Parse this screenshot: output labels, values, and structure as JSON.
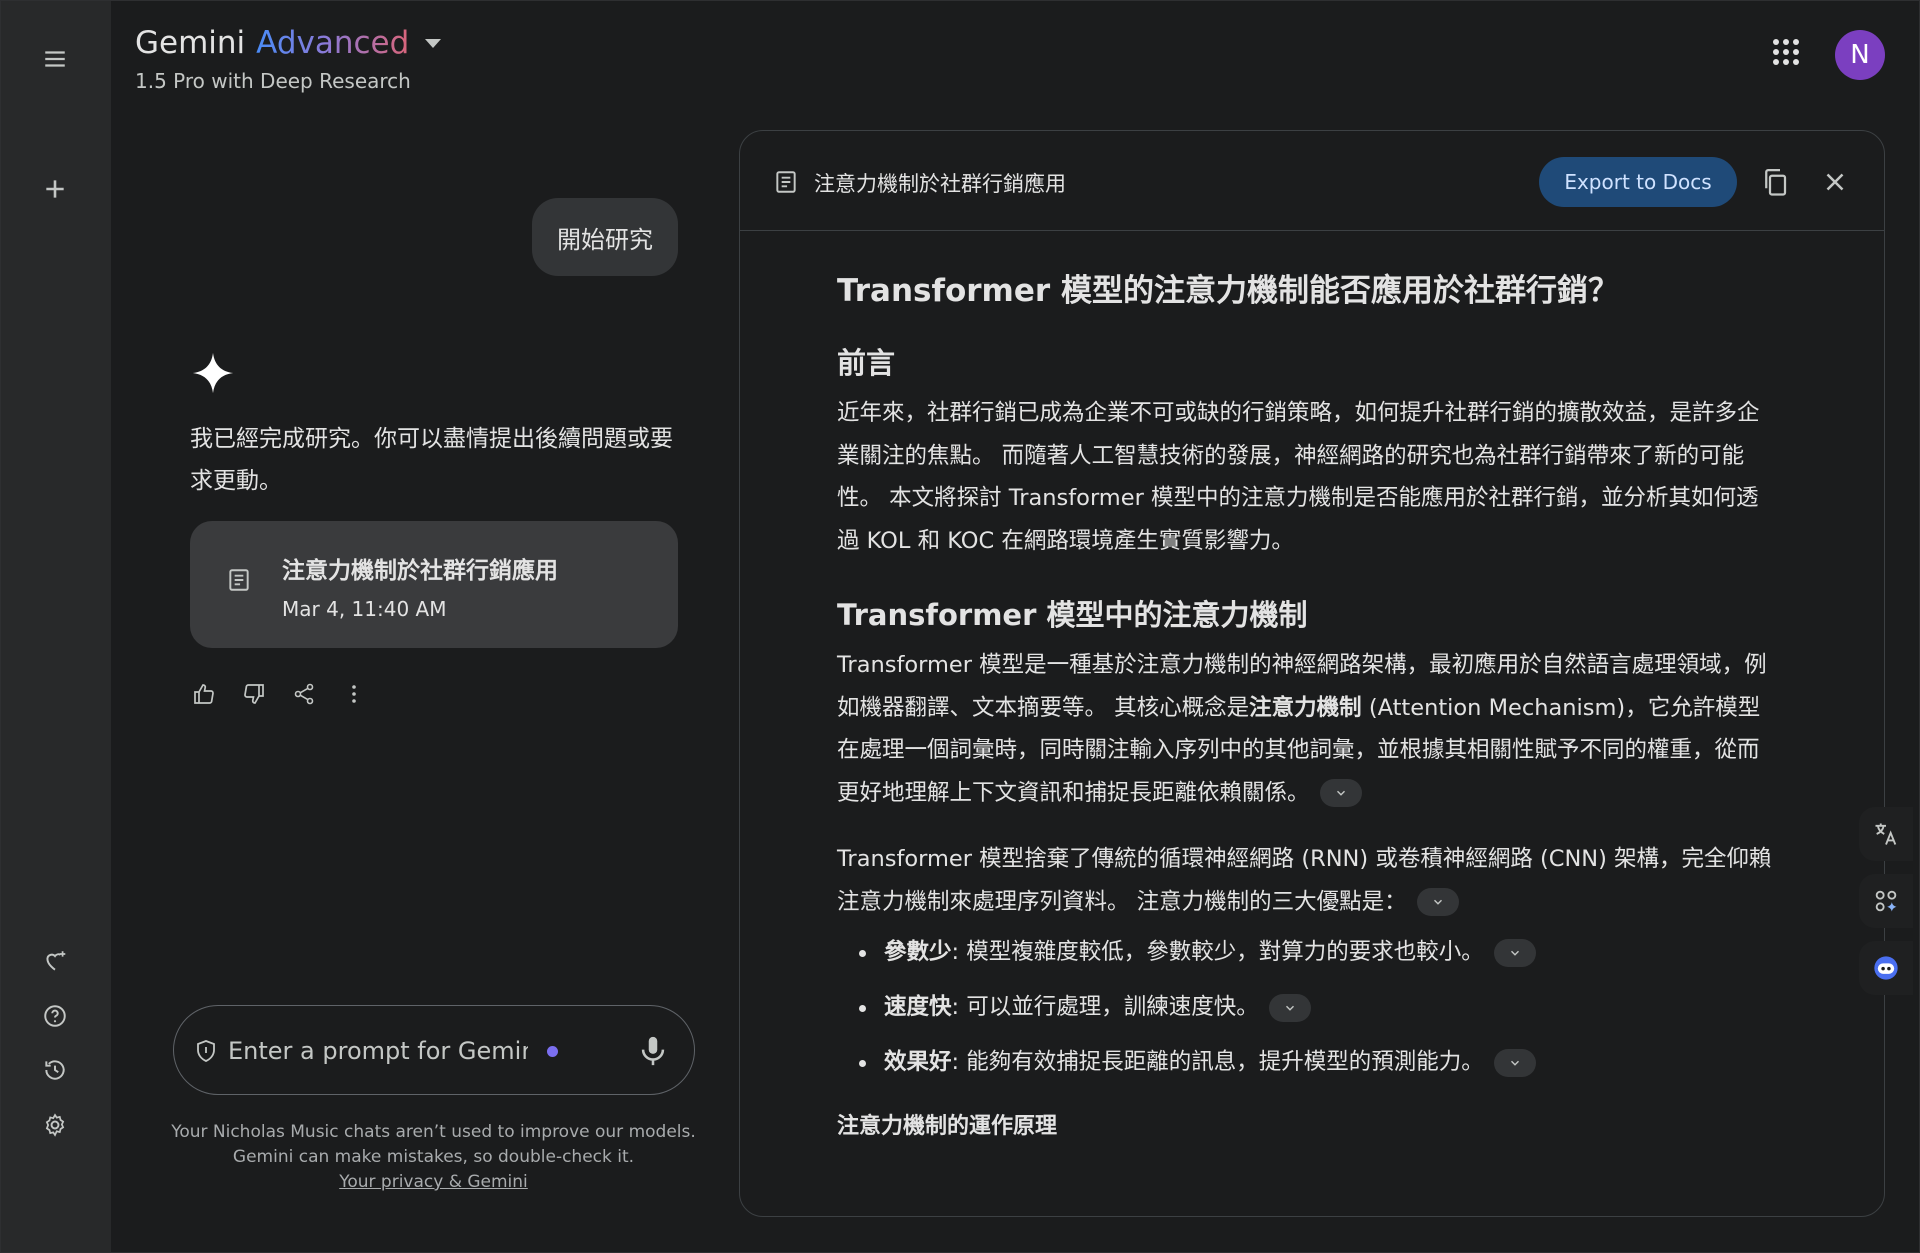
{
  "header": {
    "brand_name": "Gemini",
    "brand_tier": "Advanced",
    "model_label": "1.5 Pro with Deep Research",
    "avatar_initial": "N"
  },
  "sidebar": {
    "icons": [
      "menu-icon",
      "new-chat-icon",
      "gem-manager-icon",
      "help-icon",
      "activity-icon",
      "settings-icon"
    ]
  },
  "chat": {
    "user_message": "開始研究",
    "reply_text": "我已經完成研究。你可以盡情提出後續問題或要求更動。",
    "doc_card": {
      "title": "注意力機制於社群行銷應用",
      "date": "Mar 4, 11:40 AM"
    },
    "prompt": {
      "placeholder": "Enter a prompt for Gemini"
    },
    "disclaimer_line1": "Your Nicholas Music chats aren’t used to improve our models.",
    "disclaimer_line2": "Gemini can make mistakes, so double-check it.",
    "privacy_link": "Your privacy & Gemini"
  },
  "panel": {
    "title": "注意力機制於社群行銷應用",
    "export_label": "Export to Docs",
    "doc": {
      "h1": "Transformer 模型的注意力機制能否應用於社群行銷？",
      "intro_heading": "前言",
      "intro_text": "近年來，社群行銷已成為企業不可或缺的行銷策略，如何提升社群行銷的擴散效益，是許多企業關注的焦點。 而隨著人工智慧技術的發展，神經網路的研究也為社群行銷帶來了新的可能性。 本文將探討 Transformer 模型中的注意力機制是否能應用於社群行銷，並分析其如何透過 KOL 和 KOC 在網路環境產生實質影響力。",
      "section_heading": "Transformer 模型中的注意力機制",
      "para1_a": "Transformer 模型是一種基於注意力機制的神經網路架構，最初應用於自然語言處理領域，例如機器翻譯、文本摘要等。 其核心概念是",
      "para1_bold": "注意力機制",
      "para1_b": " (Attention Mechanism)，它允許模型在處理一個詞彙時，同時關注輸入序列中的其他詞彙，並根據其相關性賦予不同的權重，從而更好地理解上下文資訊和捕捉長距離依賴關係。",
      "para2": "Transformer 模型捨棄了傳統的循環神經網路 (RNN) 或卷積神經網路 (CNN) 架構，完全仰賴注意力機制來處理序列資料。  注意力機制的三大優點是：",
      "bullets": [
        {
          "bold": "參數少",
          "text": ": 模型複雜度較低，參數較少，對算力的要求也較小。"
        },
        {
          "bold": "速度快",
          "text": ": 可以並行處理，訓練速度快。"
        },
        {
          "bold": "效果好",
          "text": ": 能夠有效捕捉長距離的訊息，提升模型的預測能力。"
        }
      ],
      "subheading": "注意力機制的運作原理"
    }
  },
  "colors": {
    "background": "#1b1c1d",
    "rail": "#28292a",
    "accent_button": "#1f4a78",
    "avatar": "#7b3fc0"
  }
}
